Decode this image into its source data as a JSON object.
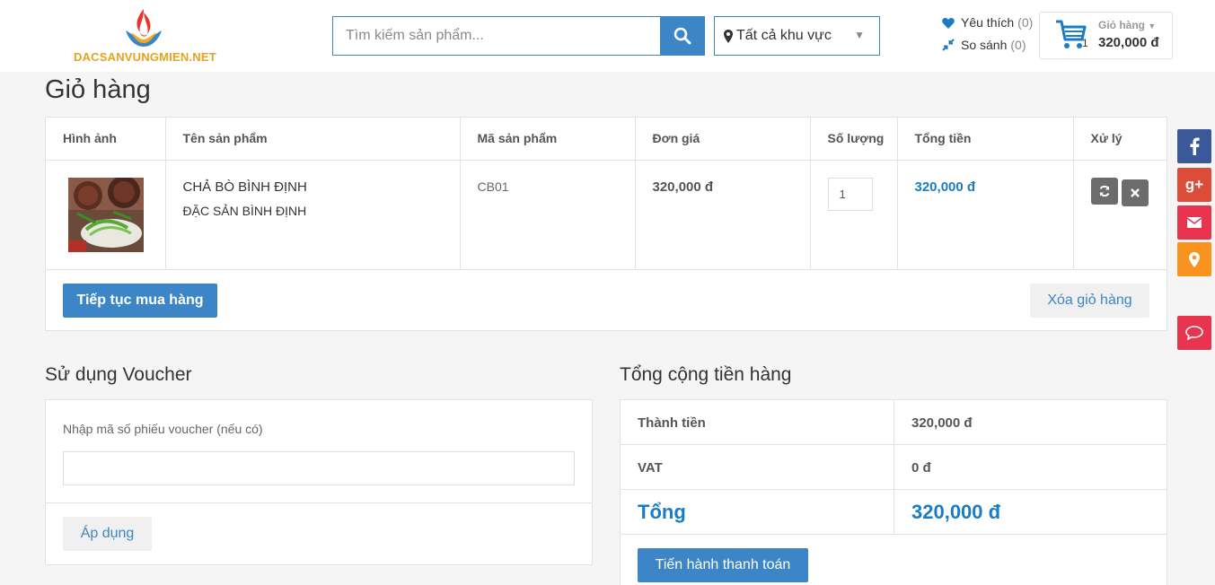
{
  "header": {
    "logo_text": "DACSANVUNGMIEN.NET",
    "search_placeholder": "Tìm kiếm sản phẩm...",
    "region_label": "Tất cả khu vực",
    "wishlist_label": "Yêu thích",
    "wishlist_count": "(0)",
    "compare_label": "So sánh",
    "compare_count": "(0)",
    "cart_label": "Giỏ hàng",
    "cart_qty": "1",
    "cart_total": "320,000 đ"
  },
  "page": {
    "title": "Giỏ hàng"
  },
  "cart_table": {
    "headers": [
      "Hình ảnh",
      "Tên sản phẩm",
      "Mã sản phẩm",
      "Đơn giá",
      "Số lượng",
      "Tổng tiền",
      "Xử lý"
    ],
    "rows": [
      {
        "name": "CHẢ BÒ BÌNH ĐỊNH",
        "category": "ĐẶC SẢN BÌNH ĐỊNH",
        "code": "CB01",
        "price": "320,000 đ",
        "quantity": "1",
        "total": "320,000 đ"
      }
    ],
    "continue_label": "Tiếp tục mua hàng",
    "clear_label": "Xóa giỏ hàng"
  },
  "voucher": {
    "title": "Sử dụng Voucher",
    "label": "Nhập mã số phiếu voucher (nếu có)",
    "value": "",
    "apply_label": "Áp dụng"
  },
  "totals": {
    "title": "Tổng cộng tiền hàng",
    "rows": [
      {
        "label": "Thành tiền",
        "value": "320,000 đ"
      },
      {
        "label": "VAT",
        "value": "0 đ"
      },
      {
        "label": "Tổng",
        "value": "320,000 đ"
      }
    ],
    "checkout_label": "Tiến hành thanh toán"
  },
  "colors": {
    "accent": "#3c86c7",
    "price_blue": "#1a7cc4",
    "facebook": "#3b5998",
    "google_plus": "#dd4b39",
    "email": "#e8344e",
    "location": "#f7931e",
    "chat": "#e8344e"
  },
  "icons": [
    "search-icon",
    "map-pin-icon",
    "heart-icon",
    "compare-icon",
    "cart-icon",
    "refresh-icon",
    "close-icon",
    "facebook-icon",
    "google-plus-icon",
    "email-icon",
    "location-icon",
    "chat-icon"
  ]
}
